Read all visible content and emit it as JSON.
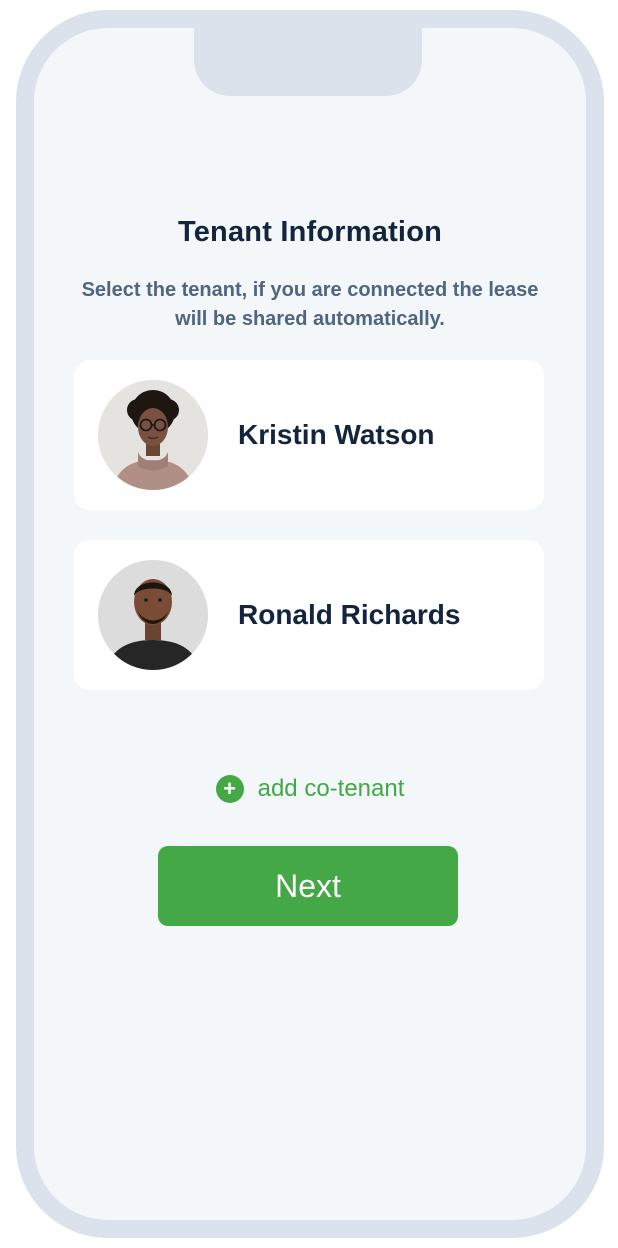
{
  "screen": {
    "title": "Tenant Information",
    "subtitle": "Select the tenant, if you are connected the lease will be shared automatically."
  },
  "tenants": [
    {
      "name": "Kristin Watson",
      "avatar": "avatar-woman-photo"
    },
    {
      "name": "Ronald Richards",
      "avatar": "avatar-man-photo"
    }
  ],
  "actions": {
    "add_icon": "plus-icon",
    "add_label": "add co-tenant",
    "next_label": "Next"
  },
  "colors": {
    "accent": "#43a845",
    "title": "#13253d",
    "subtitle": "#4f6580",
    "frame": "#dce2eb",
    "background": "#f4f7fa",
    "card": "#ffffff"
  }
}
